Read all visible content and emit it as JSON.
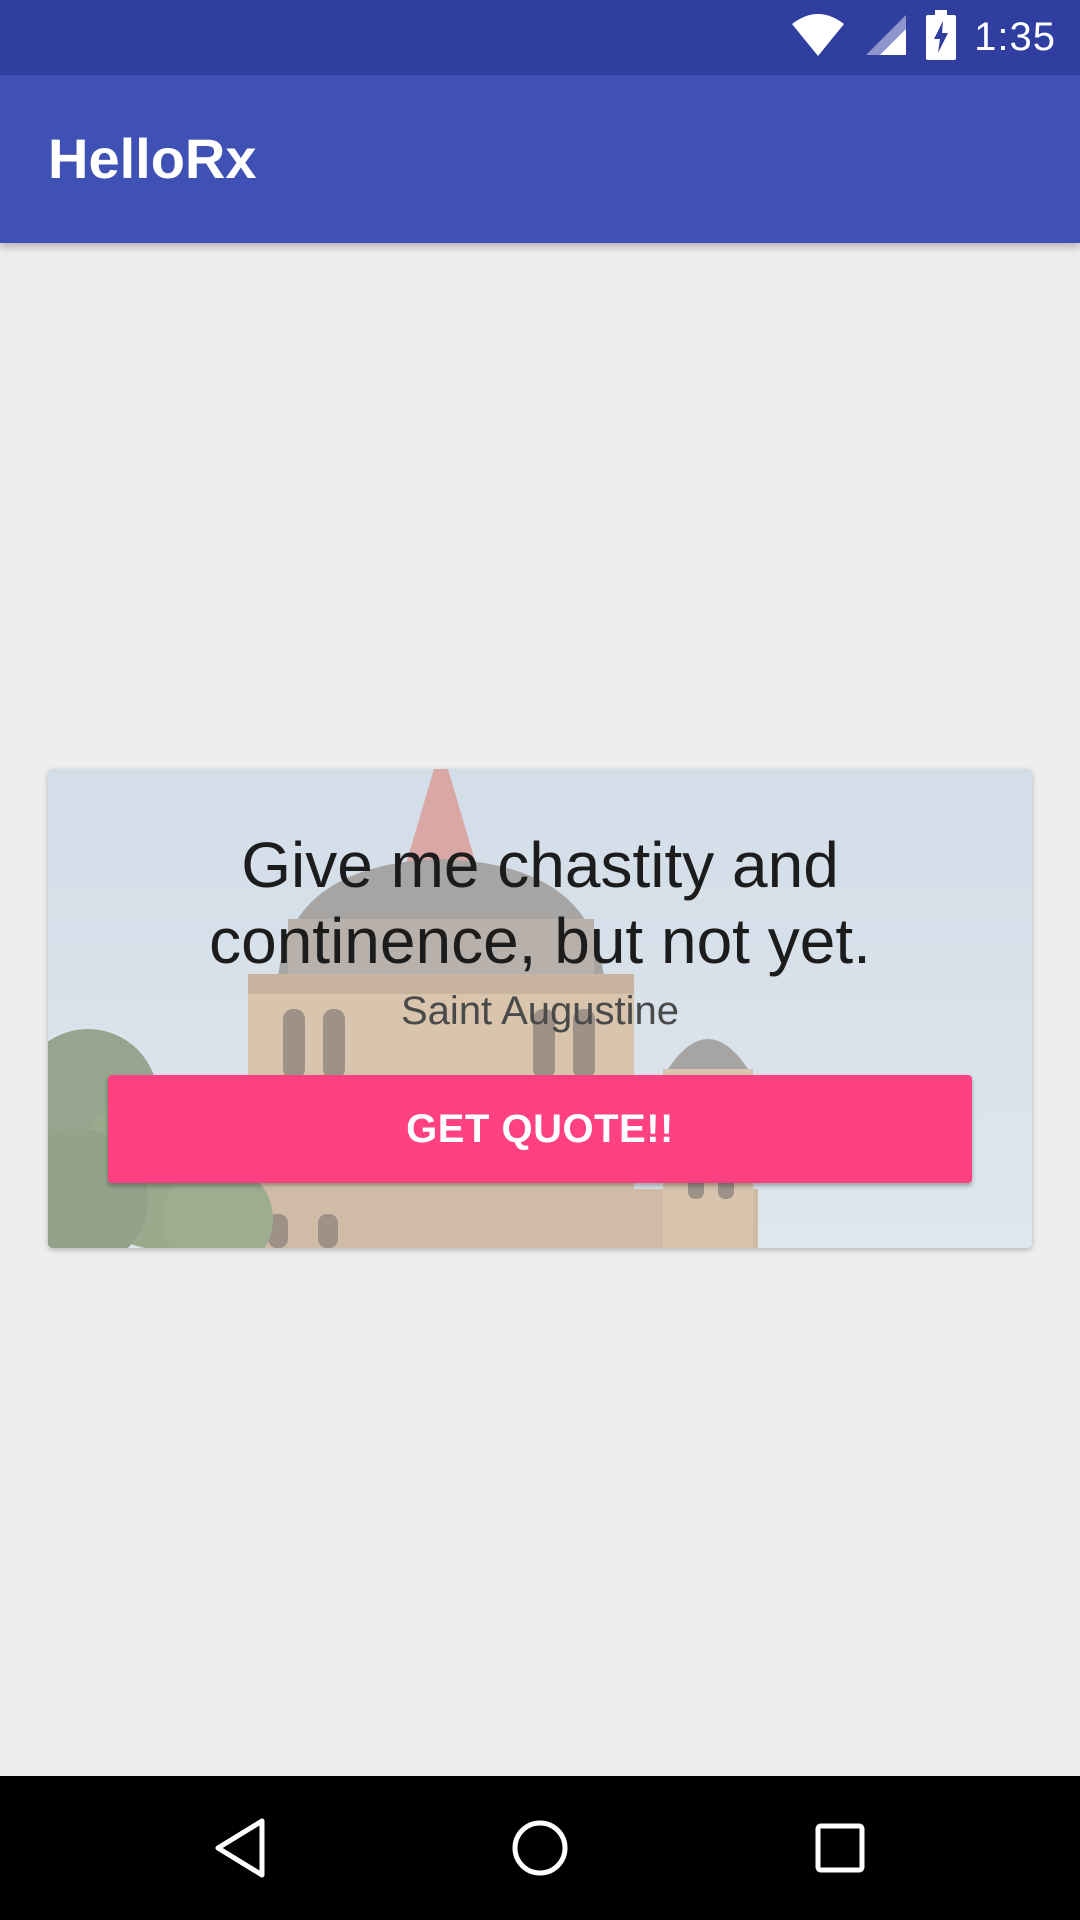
{
  "status_bar": {
    "time": "1:35",
    "icons": [
      "wifi-icon",
      "cell-signal-icon",
      "battery-charging-icon"
    ]
  },
  "app_bar": {
    "title": "HelloRx",
    "color": "#3f51b5"
  },
  "quote_card": {
    "quote": "Give me chastity and continence, but not yet.",
    "author": "Saint Augustine",
    "button_label": "GET QUOTE!!",
    "button_color": "#ff4081",
    "background_image": "cathedral-photo"
  },
  "nav_bar": {
    "icons": [
      "back-icon",
      "home-icon",
      "recents-icon"
    ]
  }
}
